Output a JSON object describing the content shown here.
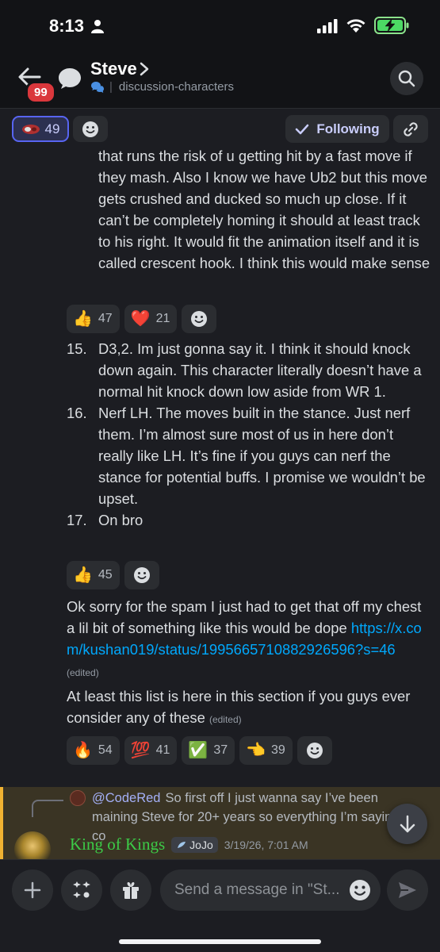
{
  "status_bar": {
    "time": "8:13"
  },
  "header": {
    "badge_count": "99",
    "title": "Steve",
    "channel": "discussion-characters"
  },
  "actions": {
    "reaction_count": "49",
    "following_label": "Following"
  },
  "message": {
    "continued_paragraph": "that runs the risk of u getting hit by a fast move if they mash. Also I know we have Ub2 but this move gets crushed and ducked so much up close. If it can’t be completely homing it should at least track to his right. It would fit the animation itself and it is called crescent hook. I think this would make sense",
    "reactions_1": [
      {
        "emoji": "👍",
        "count": "47"
      },
      {
        "emoji": "❤️",
        "count": "21"
      }
    ],
    "list": [
      {
        "num": "15.",
        "text": "D3,2. Im just gonna say it. I think it should knock down again. This character literally doesn’t have a normal hit knock down low aside from WR 1."
      },
      {
        "num": "16.",
        "text": "Nerf LH. The moves built in the stance. Just nerf them. I’m almost sure most of us in here don’t really like LH. It’s fine if you guys can nerf the stance for potential buffs. I promise we wouldn’t be upset."
      },
      {
        "num": "17.",
        "text": "On bro"
      }
    ],
    "reactions_2": [
      {
        "emoji": "👍",
        "count": "45"
      }
    ],
    "sorry_text": "Ok sorry for the spam I just had to get that off my chest a lil bit of something like this would be dope",
    "link_text": "https://x.com/kushan019/status/1995665710882926596?s=46",
    "edited_label": "(edited)",
    "list_here_text": "At least this list is here in this section if you guys ever consider any of these",
    "reactions_3": [
      {
        "emoji": "🔥",
        "count": "54"
      },
      {
        "emoji": "💯",
        "count": "41"
      },
      {
        "emoji": "✅",
        "count": "37"
      },
      {
        "emoji": "👈",
        "count": "39"
      }
    ]
  },
  "reply": {
    "reply_user": "@CodeRed",
    "reply_preview": "So first off I just wanna say I’ve been maining Steve for 20+ years so everything I’m saying co",
    "author_name": "King of Kings",
    "author_tag": "JoJo",
    "timestamp": "3/19/26, 7:01 AM"
  },
  "input": {
    "placeholder": "Send a message in \"St..."
  },
  "colors": {
    "accent": "#5865f2",
    "link": "#00a8fc",
    "author_name": "#3ccb47",
    "badge": "#da373c"
  }
}
